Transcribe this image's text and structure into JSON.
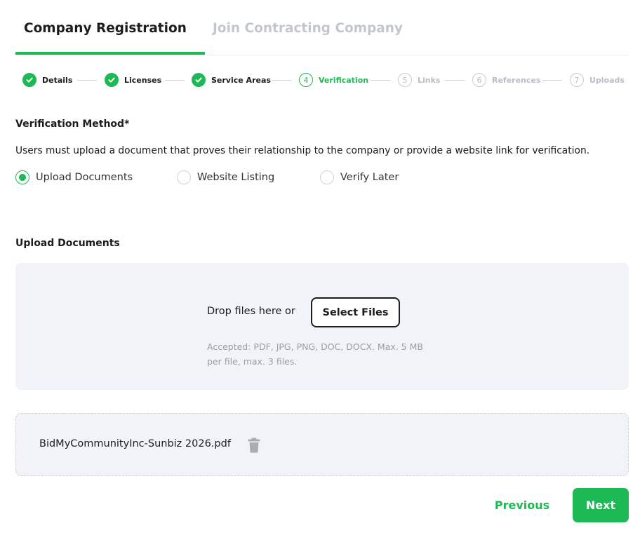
{
  "tabs": [
    {
      "label": "Company Registration",
      "active": true
    },
    {
      "label": "Join Contracting Company",
      "active": false
    }
  ],
  "stepper": {
    "steps": [
      {
        "number": "1",
        "label": "Details",
        "status": "done"
      },
      {
        "number": "2",
        "label": "Licenses",
        "status": "done"
      },
      {
        "number": "3",
        "label": "Service Areas",
        "status": "done"
      },
      {
        "number": "4",
        "label": "Verification",
        "status": "current"
      },
      {
        "number": "5",
        "label": "Links",
        "status": "todo"
      },
      {
        "number": "6",
        "label": "References",
        "status": "todo"
      },
      {
        "number": "7",
        "label": "Uploads",
        "status": "todo"
      }
    ]
  },
  "verification": {
    "title": "Verification Method*",
    "description": "Users must upload a document that proves their relationship to the company or provide a website link for verification.",
    "options": [
      {
        "label": "Upload Documents",
        "selected": true
      },
      {
        "label": "Website Listing",
        "selected": false
      },
      {
        "label": "Verify Later",
        "selected": false
      }
    ]
  },
  "upload": {
    "title": "Upload Documents",
    "drop_text": "Drop files here or",
    "select_label": "Select Files",
    "accepted": "Accepted: PDF, JPG, PNG, DOC, DOCX. Max. 5 MB per file, max. 3 files."
  },
  "files": [
    {
      "name": "BidMyCommunityInc-Sunbiz 2026.pdf",
      "icon": "trash-icon"
    }
  ],
  "footer": {
    "previous_label": "Previous",
    "next_label": "Next"
  },
  "colors": {
    "accent": "#1db954",
    "muted": "#b9bdc4",
    "panel": "#f2f3f8"
  }
}
